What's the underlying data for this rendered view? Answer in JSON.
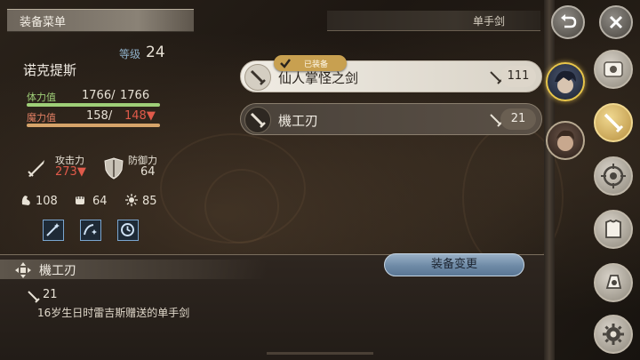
{
  "header": {
    "menu_title": "装备菜单",
    "weapon_type": "单手剑"
  },
  "character": {
    "name": "诺克提斯",
    "level_label": "等级",
    "level": "24",
    "hp_label": "体力值",
    "hp_current": "1766/",
    "hp_max": "1766",
    "hp_fraction": 1.0,
    "mp_label": "魔力值",
    "mp_current": "158/",
    "mp_max": "148▼",
    "mp_fraction": 1.0,
    "attack_label": "攻击力",
    "attack_value": "273▼",
    "defense_label": "防御力",
    "defense_value": "64",
    "strength_value": "108",
    "vitality_value": "64",
    "magic_value": "85"
  },
  "equipment_list": [
    {
      "name": "仙人掌怪之剑",
      "attack": "111",
      "equipped": true,
      "icon": "sword-icon"
    },
    {
      "name": "機工刃",
      "attack": "21",
      "equipped": false,
      "icon": "sword-icon"
    }
  ],
  "equipped_badge": "已装备",
  "selected_item": {
    "name": "機工刃",
    "attack": "21",
    "description": "16岁生日时雷吉斯赠送的单手剑"
  },
  "buttons": {
    "change_equipment": "装备变更"
  },
  "colors": {
    "hp": "#9fcf78",
    "mp": "#e07f63",
    "accent_gold": "#e8c64a",
    "decrease_red": "#e05a4a"
  },
  "right_menu_icons": [
    "back-icon",
    "close-icon",
    "weapon-sword-icon",
    "target-icon",
    "armor-icon",
    "accessory-icon",
    "settings-icon"
  ]
}
